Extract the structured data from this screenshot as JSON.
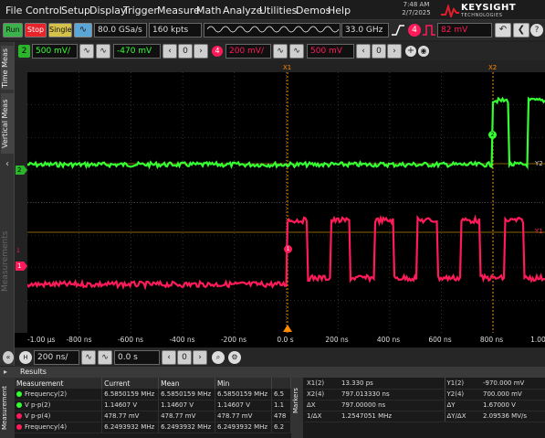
{
  "menu": [
    "File",
    "Control",
    "Setup",
    "Display",
    "Trigger",
    "Measure",
    "Math",
    "Analyze",
    "Utilities",
    "Demos",
    "Help"
  ],
  "clock": {
    "time": "7:48 AM",
    "date": "2/7/2025"
  },
  "brand": {
    "name": "KEYSIGHT",
    "sub": "TECHNOLOGIES"
  },
  "toolbar": {
    "run": "Run",
    "stop": "Stop",
    "single": "Single",
    "sample_rate": "80.0 GSa/s",
    "points": "160 kpts",
    "bandwidth": "33.0 GHz",
    "trigger_level": "82 mV"
  },
  "channels": {
    "ch2_label": "2",
    "ch2_scale": "500 mV/",
    "ch2_offset": "-470 mV",
    "ch4_scale": "200 mV/",
    "ch4_offset": "500 mV"
  },
  "sidebar": {
    "time_meas": "Time Meas",
    "vertical_meas": "Vertical Meas",
    "measurements": "Measurements",
    "markers": "Markers",
    "measurement_tab": "Measurement"
  },
  "scope": {
    "cursor_x1": "X1",
    "cursor_x2": "X2",
    "cursor_y1": "Y1",
    "cursor_y2": "Y2",
    "ch2_marker": "2",
    "ch4_marker": "1",
    "ch4_left_marker": "1",
    "colors": {
      "ch2": "#33ff33",
      "ch4": "#ff1a5a",
      "cursor": "#ff8c00",
      "cursor_y": "#b8860b",
      "grid": "#555555"
    }
  },
  "time_axis": [
    "-1.00 µs",
    "-800 ns",
    "-600 ns",
    "-400 ns",
    "-200 ns",
    "0.0 s",
    "200 ns",
    "400 ns",
    "600 ns",
    "800 ns",
    "1.00 µs"
  ],
  "horizontal": {
    "scale": "200 ns/",
    "position": "0.0 s"
  },
  "results": {
    "title": "Results",
    "headers": [
      "Measurement",
      "Current",
      "Mean",
      "Min",
      ""
    ],
    "rows": [
      {
        "name": "Frequency(2)",
        "current": "6.5850159 MHz",
        "mean": "6.5850159 MHz",
        "min": "6.5850159 MHz",
        "max": "6.5",
        "color": "#33ff33"
      },
      {
        "name": "V p-p(2)",
        "current": "1.14607 V",
        "mean": "1.14607 V",
        "min": "1.14607 V",
        "max": "1.1",
        "color": "#33ff33"
      },
      {
        "name": "V p-p(4)",
        "current": "478.77 mV",
        "mean": "478.77 mV",
        "min": "478.77 mV",
        "max": "478",
        "color": "#ff1a5a"
      },
      {
        "name": "Frequency(4)",
        "current": "6.2493932 MHz",
        "mean": "6.2493932 MHz",
        "min": "6.2493932 MHz",
        "max": "6.2",
        "color": "#ff1a5a"
      }
    ]
  },
  "markers": {
    "rows": [
      {
        "k1": "X1(2)",
        "v1": "13.330 ps",
        "k2": "Y1(2)",
        "v2": "-970.000 mV"
      },
      {
        "k1": "X2(4)",
        "v1": "797.013330 ns",
        "k2": "Y2(4)",
        "v2": "700.000 mV"
      },
      {
        "k1": "ΔX",
        "v1": "797.00000 ns",
        "k2": "ΔY",
        "v2": "1.67000 V"
      },
      {
        "k1": "1/ΔX",
        "v1": "1.2547051 MHz",
        "k2": "ΔY/ΔX",
        "v2": "2.09536 MV/s"
      }
    ]
  }
}
